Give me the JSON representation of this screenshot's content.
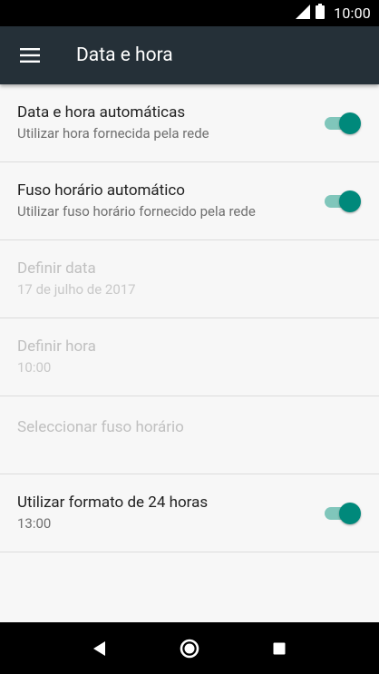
{
  "status_bar": {
    "time": "10:00",
    "icons": [
      "signal-icon",
      "battery-icon"
    ]
  },
  "app_bar": {
    "title": "Data e hora",
    "menu_icon": "hamburger-menu-icon"
  },
  "settings": [
    {
      "title": "Data e hora automáticas",
      "summary": "Utilizar hora fornecida pela rede",
      "toggle": true,
      "enabled": true
    },
    {
      "title": "Fuso horário automático",
      "summary": "Utilizar fuso horário fornecido pela rede",
      "toggle": true,
      "enabled": true
    },
    {
      "title": "Definir data",
      "summary": "17 de julho de 2017",
      "enabled": false
    },
    {
      "title": "Definir hora",
      "summary": "10:00",
      "enabled": false
    },
    {
      "title": "Seleccionar fuso horário",
      "enabled": false
    },
    {
      "title": "Utilizar formato de 24 horas",
      "summary": "13:00",
      "toggle": true,
      "enabled": true
    }
  ],
  "nav_bar": {
    "buttons": [
      "back-icon",
      "home-icon",
      "recents-icon"
    ]
  },
  "colors": {
    "app_bar": "#253038",
    "accent": "#00897b",
    "background": "#f7f7f7"
  }
}
